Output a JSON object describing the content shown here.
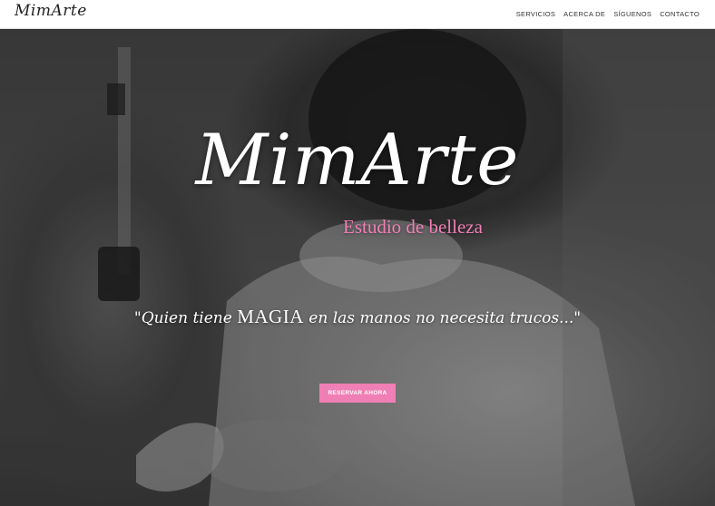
{
  "header": {
    "logo": "MimArte",
    "nav": [
      "SERVICIOS",
      "ACERCA DE",
      "SÍGUENOS",
      "CONTACTO"
    ]
  },
  "hero": {
    "title": "MimArte",
    "subtitle": "Estudio de belleza",
    "quote_before": "\"Quien tiene ",
    "quote_emphasis": "MAGIA",
    "quote_after": " en las manos no necesita trucos...\"",
    "cta_label": "RESERVAR AHORA"
  },
  "colors": {
    "accent": "#f07fb5",
    "nav_bg": "#ffffff",
    "text_light": "#ffffff"
  }
}
